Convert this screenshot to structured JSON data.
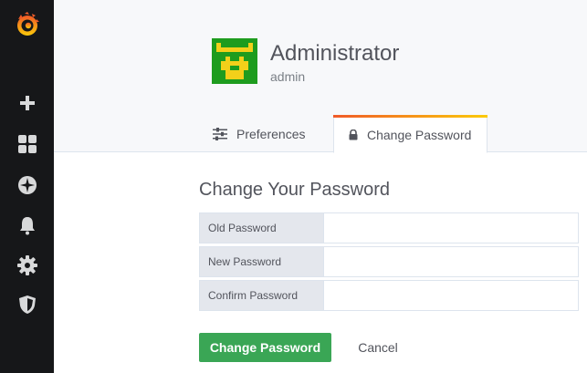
{
  "sidebar": {
    "items": [
      {
        "icon": "grafana-logo-icon"
      },
      {
        "icon": "plus-icon"
      },
      {
        "icon": "dashboards-icon"
      },
      {
        "icon": "explore-compass-icon"
      },
      {
        "icon": "alerting-bell-icon"
      },
      {
        "icon": "configuration-gear-icon"
      },
      {
        "icon": "shield-icon"
      }
    ]
  },
  "header": {
    "name": "Administrator",
    "login": "admin",
    "tabs": [
      {
        "label": "Preferences",
        "icon": "sliders-icon",
        "active": false
      },
      {
        "label": "Change Password",
        "icon": "lock-icon",
        "active": true
      }
    ]
  },
  "form": {
    "title": "Change Your Password",
    "fields": [
      {
        "label": "Old Password",
        "value": ""
      },
      {
        "label": "New Password",
        "value": ""
      },
      {
        "label": "Confirm Password",
        "value": ""
      }
    ],
    "submit_label": "Change Password",
    "cancel_label": "Cancel"
  },
  "colors": {
    "sidebar_bg": "#161719",
    "primary_button": "#3aa655",
    "tab_accent_start": "#f05a28",
    "tab_accent_end": "#fbca0a"
  }
}
